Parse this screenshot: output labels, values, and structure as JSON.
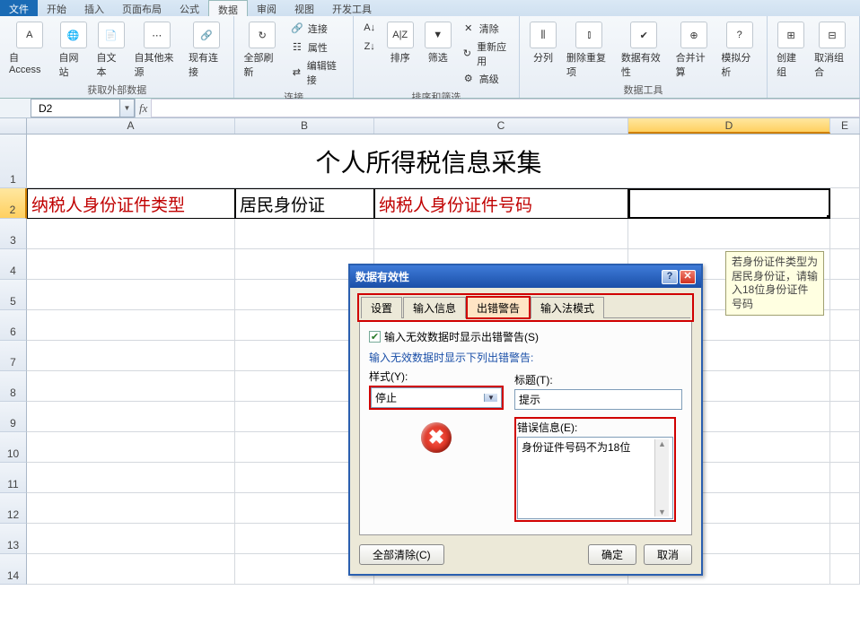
{
  "ribbonTabs": [
    "文件",
    "开始",
    "插入",
    "页面布局",
    "公式",
    "数据",
    "审阅",
    "视图",
    "开发工具"
  ],
  "activeRibbonTab": "数据",
  "ribbon": {
    "group1": {
      "label": "获取外部数据",
      "access": "自 Access",
      "web": "自网站",
      "text": "自文本",
      "other": "自其他来源",
      "existing": "现有连接"
    },
    "group2": {
      "label": "连接",
      "refresh": "全部刷新",
      "conn": "连接",
      "prop": "属性",
      "editlink": "编辑链接"
    },
    "group3": {
      "label": "排序和筛选",
      "sort": "排序",
      "filter": "筛选",
      "clear": "清除",
      "reapply": "重新应用",
      "advanced": "高级"
    },
    "group4": {
      "label": "数据工具",
      "split": "分列",
      "dedup": "删除重复项",
      "valid": "数据有效性",
      "consol": "合并计算",
      "whatif": "模拟分析"
    },
    "group5": {
      "label": "",
      "group": "创建组",
      "ungroup": "取消组合"
    }
  },
  "nameBox": "D2",
  "formula": "",
  "columns": [
    "A",
    "B",
    "C",
    "D",
    "E"
  ],
  "selectedCol": "D",
  "selectedRow": "2",
  "rowHeaders": [
    "1",
    "2",
    "3",
    "4",
    "5",
    "6",
    "7",
    "8",
    "9",
    "10",
    "11",
    "12",
    "13",
    "14"
  ],
  "sheet": {
    "title": "个人所得税信息采集",
    "a2": "纳税人身份证件类型",
    "b2": "居民身份证",
    "c2": "纳税人身份证件号码",
    "d2": ""
  },
  "tooltip": "若身份证件类型为居民身份证，请输入18位身份证件号码",
  "dialog": {
    "title": "数据有效性",
    "tabs": [
      "设置",
      "输入信息",
      "出错警告",
      "输入法模式"
    ],
    "activeTab": "出错警告",
    "chkLabel": "输入无效数据时显示出错警告(S)",
    "sectionLabel": "输入无效数据时显示下列出错警告:",
    "styleLabel": "样式(Y):",
    "styleValue": "停止",
    "titleLabel": "标题(T):",
    "titleValue": "提示",
    "errLabel": "错误信息(E):",
    "errValue": "身份证件号码不为18位",
    "clearBtn": "全部清除(C)",
    "okBtn": "确定",
    "cancelBtn": "取消"
  }
}
